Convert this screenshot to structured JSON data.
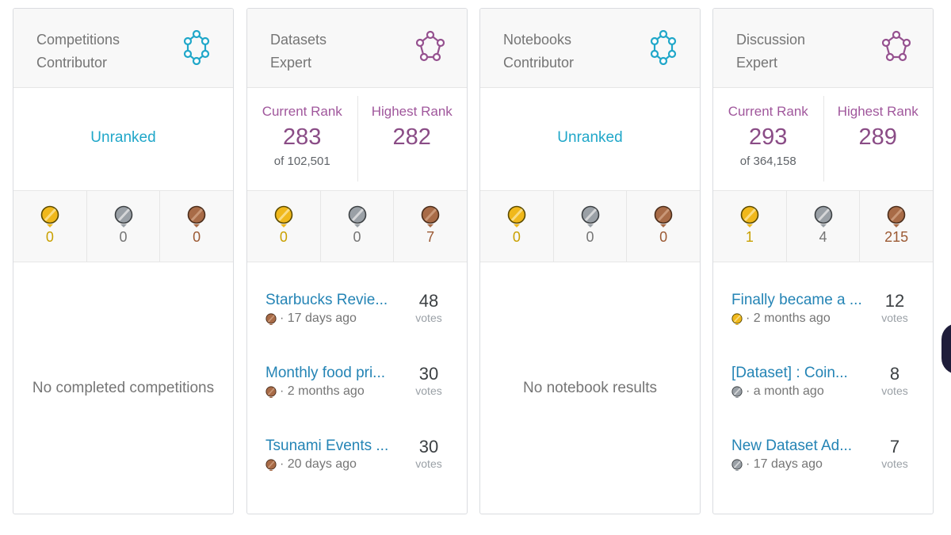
{
  "colors": {
    "accent_blue": "#20a7c9",
    "accent_purple": "#a0579c",
    "gold": "#f0b81b",
    "silver": "#9aa0a6",
    "bronze": "#a86b47",
    "link": "#2484b5"
  },
  "cards": [
    {
      "tier_line1": "Competitions",
      "tier_line2": "Contributor",
      "tier_icon": "contributor-hex-icon",
      "unranked_label": "Unranked",
      "medals": {
        "gold": "0",
        "silver": "0",
        "bronze": "0"
      },
      "empty_message": "No completed competitions"
    },
    {
      "tier_line1": "Datasets",
      "tier_line2": "Expert",
      "tier_icon": "expert-pentagon-icon",
      "current_rank_label": "Current Rank",
      "current_rank": "283",
      "current_rank_of": "of 102,501",
      "highest_rank_label": "Highest Rank",
      "highest_rank": "282",
      "medals": {
        "gold": "0",
        "silver": "0",
        "bronze": "7"
      },
      "items": [
        {
          "title": "Starbucks Revie...",
          "medal": "bronze",
          "time": "· 17 days ago",
          "votes": "48",
          "votes_label": "votes"
        },
        {
          "title": "Monthly food pri...",
          "medal": "bronze",
          "time": "· 2 months ago",
          "votes": "30",
          "votes_label": "votes"
        },
        {
          "title": "Tsunami Events ...",
          "medal": "bronze",
          "time": "· 20 days ago",
          "votes": "30",
          "votes_label": "votes"
        }
      ]
    },
    {
      "tier_line1": "Notebooks",
      "tier_line2": "Contributor",
      "tier_icon": "contributor-hex-icon",
      "unranked_label": "Unranked",
      "medals": {
        "gold": "0",
        "silver": "0",
        "bronze": "0"
      },
      "empty_message": "No notebook results"
    },
    {
      "tier_line1": "Discussion",
      "tier_line2": "Expert",
      "tier_icon": "expert-pentagon-icon",
      "current_rank_label": "Current Rank",
      "current_rank": "293",
      "current_rank_of": "of 364,158",
      "highest_rank_label": "Highest Rank",
      "highest_rank": "289",
      "medals": {
        "gold": "1",
        "silver": "4",
        "bronze": "215"
      },
      "items": [
        {
          "title": "Finally became a ...",
          "medal": "gold",
          "time": "· 2 months ago",
          "votes": "12",
          "votes_label": "votes"
        },
        {
          "title": "[Dataset] : Coin...",
          "medal": "silver",
          "time": "· a month ago",
          "votes": "8",
          "votes_label": "votes"
        },
        {
          "title": "New Dataset Ad...",
          "medal": "silver",
          "time": "· 17 days ago",
          "votes": "7",
          "votes_label": "votes"
        }
      ]
    }
  ]
}
